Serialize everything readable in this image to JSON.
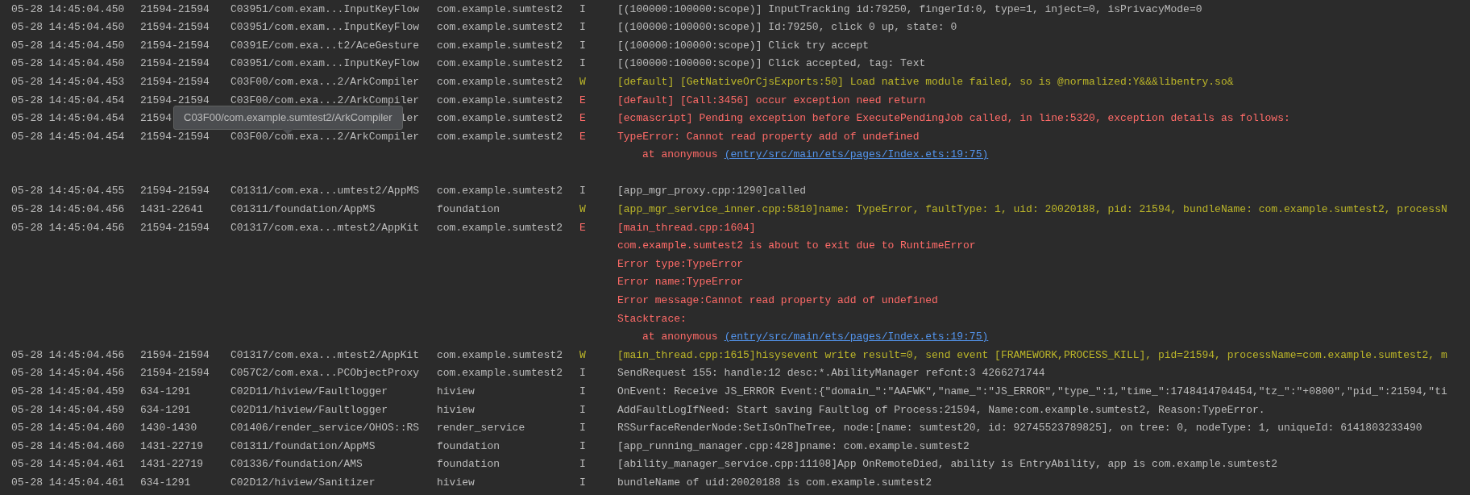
{
  "rows": [
    {
      "time": "05-28 14:45:04.450",
      "pid": "21594-21594",
      "tag": "C03951/com.exam...InputKeyFlow",
      "package": "com.example.sumtest2",
      "level": "I",
      "lines": [
        {
          "kind": "text",
          "text": "[(100000:100000:scope)] InputTracking id:79250, fingerId:0, type=1, inject=0, isPrivacyMode=0"
        }
      ]
    },
    {
      "time": "05-28 14:45:04.450",
      "pid": "21594-21594",
      "tag": "C03951/com.exam...InputKeyFlow",
      "package": "com.example.sumtest2",
      "level": "I",
      "lines": [
        {
          "kind": "text",
          "text": "[(100000:100000:scope)] Id:79250, click 0 up, state: 0"
        }
      ]
    },
    {
      "time": "05-28 14:45:04.450",
      "pid": "21594-21594",
      "tag": "C0391E/com.exa...t2/AceGesture",
      "package": "com.example.sumtest2",
      "level": "I",
      "lines": [
        {
          "kind": "text",
          "text": "[(100000:100000:scope)] Click try accept"
        }
      ]
    },
    {
      "time": "05-28 14:45:04.450",
      "pid": "21594-21594",
      "tag": "C03951/com.exam...InputKeyFlow",
      "package": "com.example.sumtest2",
      "level": "I",
      "lines": [
        {
          "kind": "text",
          "text": "[(100000:100000:scope)] Click accepted, tag: Text"
        }
      ]
    },
    {
      "time": "05-28 14:45:04.453",
      "pid": "21594-21594",
      "tag": "C03F00/com.exa...2/ArkCompiler",
      "package": "com.example.sumtest2",
      "level": "W",
      "lines": [
        {
          "kind": "text",
          "text": "[default] [GetNativeOrCjsExports:50] Load native module failed, so is @normalized:Y&&&libentry.so&"
        }
      ]
    },
    {
      "time": "05-28 14:45:04.454",
      "pid": "21594-21594",
      "tag": "C03F00/com.exa...2/ArkCompiler",
      "package": "com.example.sumtest2",
      "level": "E",
      "lines": [
        {
          "kind": "text",
          "text": "[default] [Call:3456] occur exception need return"
        }
      ]
    },
    {
      "time": "05-28 14:45:04.454",
      "pid": "21594",
      "tag": "ler",
      "package": "com.example.sumtest2",
      "level": "E",
      "tooltip": "C03F00/com.example.sumtest2/ArkCompiler",
      "lines": [
        {
          "kind": "text",
          "text": "[ecmascript] Pending exception before ExecutePendingJob called, in line:5320, exception details as follows:"
        }
      ]
    },
    {
      "time": "05-28 14:45:04.454",
      "pid": "21594-21594",
      "tag": "C03F00/com.exa...2/ArkCompiler",
      "package": "com.example.sumtest2",
      "level": "E",
      "blank_line_after": true,
      "lines": [
        {
          "kind": "text",
          "text": "TypeError: Cannot read property add of undefined"
        },
        {
          "kind": "frame",
          "text": "at anonymous",
          "link": "(entry/src/main/ets/pages/Index.ets:19:75)"
        }
      ]
    },
    {
      "time": "05-28 14:45:04.455",
      "pid": "21594-21594",
      "tag": "C01311/com.exa...umtest2/AppMS",
      "package": "com.example.sumtest2",
      "level": "I",
      "lines": [
        {
          "kind": "text",
          "text": "[app_mgr_proxy.cpp:1290]called"
        }
      ]
    },
    {
      "time": "05-28 14:45:04.456",
      "pid": "1431-22641",
      "tag": "C01311/foundation/AppMS",
      "package": "foundation",
      "level": "W",
      "lines": [
        {
          "kind": "text",
          "text": "[app_mgr_service_inner.cpp:5810]name: TypeError, faultType: 1, uid: 20020188, pid: 21594, bundleName: com.example.sumtest2, processN"
        }
      ]
    },
    {
      "time": "05-28 14:45:04.456",
      "pid": "21594-21594",
      "tag": "C01317/com.exa...mtest2/AppKit",
      "package": "com.example.sumtest2",
      "level": "E",
      "lines": [
        {
          "kind": "text",
          "text": "[main_thread.cpp:1604]"
        },
        {
          "kind": "text",
          "text": "com.example.sumtest2 is about to exit due to RuntimeError"
        },
        {
          "kind": "text",
          "text": "Error type:TypeError"
        },
        {
          "kind": "text",
          "text": "Error name:TypeError"
        },
        {
          "kind": "text",
          "text": "Error message:Cannot read property add of undefined"
        },
        {
          "kind": "text",
          "text": "Stacktrace:"
        },
        {
          "kind": "frame",
          "text": "at anonymous",
          "link": "(entry/src/main/ets/pages/Index.ets:19:75)"
        }
      ]
    },
    {
      "time": "05-28 14:45:04.456",
      "pid": "21594-21594",
      "tag": "C01317/com.exa...mtest2/AppKit",
      "package": "com.example.sumtest2",
      "level": "W",
      "lines": [
        {
          "kind": "text",
          "text": "[main_thread.cpp:1615]hisysevent write result=0, send event [FRAMEWORK,PROCESS_KILL], pid=21594, processName=com.example.sumtest2, m"
        }
      ]
    },
    {
      "time": "05-28 14:45:04.456",
      "pid": "21594-21594",
      "tag": "C057C2/com.exa...PCObjectProxy",
      "package": "com.example.sumtest2",
      "level": "I",
      "lines": [
        {
          "kind": "text",
          "text": "SendRequest 155: handle:12 desc:*.AbilityManager refcnt:3 4266271744"
        }
      ]
    },
    {
      "time": "05-28 14:45:04.459",
      "pid": "634-1291",
      "tag": "C02D11/hiview/Faultlogger",
      "package": "hiview",
      "level": "I",
      "lines": [
        {
          "kind": "text",
          "text": "OnEvent: Receive JS_ERROR Event:{\"domain_\":\"AAFWK\",\"name_\":\"JS_ERROR\",\"type_\":1,\"time_\":1748414704454,\"tz_\":\"+0800\",\"pid_\":21594,\"ti"
        }
      ]
    },
    {
      "time": "05-28 14:45:04.459",
      "pid": "634-1291",
      "tag": "C02D11/hiview/Faultlogger",
      "package": "hiview",
      "level": "I",
      "lines": [
        {
          "kind": "text",
          "text": "AddFaultLogIfNeed: Start saving Faultlog of Process:21594, Name:com.example.sumtest2, Reason:TypeError."
        }
      ]
    },
    {
      "time": "05-28 14:45:04.460",
      "pid": "1430-1430",
      "tag": "C01406/render_service/OHOS::RS",
      "package": "render_service",
      "level": "I",
      "lines": [
        {
          "kind": "text",
          "text": "RSSurfaceRenderNode:SetIsOnTheTree, node:[name: sumtest20, id: 92745523789825], on tree: 0, nodeType: 1, uniqueId: 6141803233490"
        }
      ]
    },
    {
      "time": "05-28 14:45:04.460",
      "pid": "1431-22719",
      "tag": "C01311/foundation/AppMS",
      "package": "foundation",
      "level": "I",
      "lines": [
        {
          "kind": "text",
          "text": "[app_running_manager.cpp:428]pname: com.example.sumtest2"
        }
      ]
    },
    {
      "time": "05-28 14:45:04.461",
      "pid": "1431-22719",
      "tag": "C01336/foundation/AMS",
      "package": "foundation",
      "level": "I",
      "lines": [
        {
          "kind": "text",
          "text": "[ability_manager_service.cpp:11108]App OnRemoteDied, ability is EntryAbility, app is com.example.sumtest2"
        }
      ]
    },
    {
      "time": "05-28 14:45:04.461",
      "pid": "634-1291",
      "tag": "C02D12/hiview/Sanitizer",
      "package": "hiview",
      "level": "I",
      "lines": [
        {
          "kind": "text",
          "text": "bundleName of uid:20020188 is com.example.sumtest2"
        }
      ]
    }
  ]
}
